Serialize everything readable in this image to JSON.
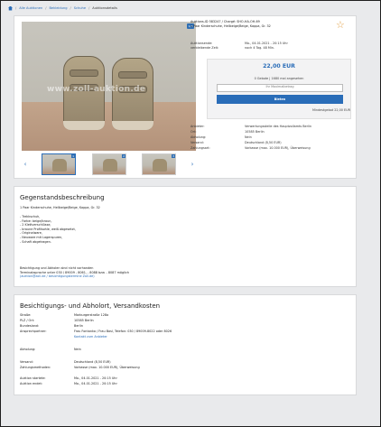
{
  "breadcrumb": [
    "Alle Auktionen",
    "Bekleidung",
    "Schuhe",
    "Auktionsdetails"
  ],
  "listing": {
    "image_count": "1/3",
    "watermark": "www.zoll-auktion.de",
    "thumb_numbers": [
      "1",
      "2",
      "3"
    ],
    "id_line": "Auktions-ID 583247 / Chargé: SHO-HA-OH-69",
    "title": "1 Paar Kinderschuhe, Hellbeige/Beige, Kappa, Gr. 32",
    "auction_end_label": "Auktionsende:",
    "auction_end_value": "Mo., 04.01.2021 - 20:15 Uhr",
    "remaining_label": "verbleibende Zeit:",
    "remaining_value": "noch 4 Tag. 48 Min.",
    "price": "22,00 EUR",
    "bids": "0 Gebote | 1680 mal angesehen",
    "max_bid_placeholder": "Ihr Maximalbetrag",
    "bid_button": "Bieten",
    "min_bid": "Mindestgebot 22,00 EUR",
    "seller": [
      {
        "k": "Anbieter:",
        "v": "Verwertungsstelle des Hauptzollamts Berlin",
        "link": true
      },
      {
        "k": "Ort:",
        "v": "10585 Berlin"
      },
      {
        "k": "Abholung:",
        "v": "Nein"
      },
      {
        "k": "Versand:",
        "v": "Deutschland (8,50 EUR)"
      },
      {
        "k": "Zahlungsart:",
        "v": "Vorkasse (max. 10.000 EUR), Überweisung"
      }
    ]
  },
  "description": {
    "heading": "Gegenstandsbeschreibung",
    "intro": "1 Paar Kinderschuhe, Hellbeige/Beige, Kappa, Gr. 32",
    "bullets": [
      "- Trekkschuh,",
      "- Farbe: beige/braun,",
      "- 2 Klettverschlüsse,",
      "- braune Profilsohle, weiß abgesetzt,",
      "- Originalware,",
      "- Neuware mit Lagerspuren,",
      "- Schaft abgetragen."
    ],
    "note1": "Besichtigung und Abholen sind nicht vorhanden",
    "note2": "Terminabsprache unter 030 / 89009 - 8061, - 8088 bzw. - 8087 möglich",
    "link": "(auktion@zoll.de / besichtigungstermine Zoll.de)"
  },
  "shipping": {
    "heading": "Besichtigungs- und Abholort, Versandkosten",
    "rows": [
      {
        "k": "Straße:",
        "v": "Marburgerstraße 128a"
      },
      {
        "k": "PLZ / Ort:",
        "v": "10585 Berlin"
      },
      {
        "k": "Bundesland:",
        "v": "Berlin"
      },
      {
        "k": "Ansprechpartner:",
        "v": "Frau Fontanka / Frau Basl, Telefon: 030 / 89009-8022 oder 8026"
      },
      {
        "k": "",
        "v": "Kontakt zum Anbieter",
        "link": true
      },
      {
        "k": "Abholung:",
        "v": "Nein"
      },
      {
        "k": "Versand:",
        "v": "Deutschland (8,50 EUR)"
      },
      {
        "k": "Zahlungsmethoden:",
        "v": "Vorkasse (max. 10.000 EUR), Überweisung"
      },
      {
        "k": "Auktion startete:",
        "v": "Mo., 04.01.2021 - 20:15 Uhr"
      },
      {
        "k": "Auktion endet:",
        "v": "Mo., 04.01.2021 - 20:15 Uhr"
      }
    ]
  }
}
